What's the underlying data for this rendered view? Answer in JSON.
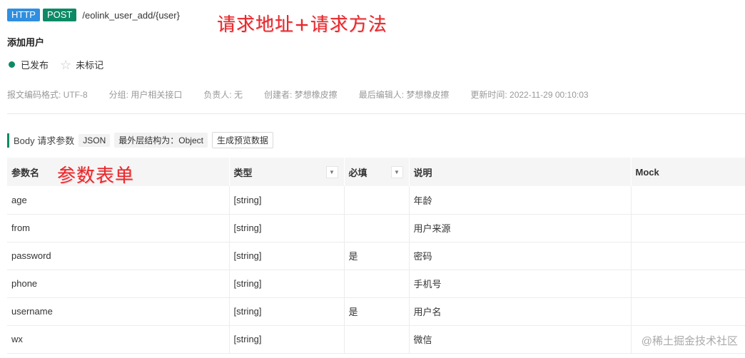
{
  "header": {
    "method_protocol": "HTTP",
    "method": "POST",
    "path": "/eolink_user_add/{user}"
  },
  "annotations": {
    "request_addr": "请求地址+请求方法",
    "param_form": "参数表单"
  },
  "api_name": "添加用户",
  "status": {
    "published": "已发布",
    "marked": "未标记"
  },
  "meta": {
    "encoding": "报文编码格式: UTF-8",
    "group": "分组: 用户相关接口",
    "owner": "负责人: 无",
    "creator": "创建者: 梦想橡皮擦",
    "last_editor": "最后编辑人: 梦想橡皮擦",
    "updated": "更新时间: 2022-11-29 00:10:03"
  },
  "body_section": {
    "label": "Body 请求参数",
    "format": "JSON",
    "structure": "最外层结构为：Object",
    "generate_button": "生成预览数据"
  },
  "table": {
    "headers": {
      "name": "参数名",
      "type": "类型",
      "required": "必填",
      "desc": "说明",
      "mock": "Mock"
    },
    "rows": [
      {
        "name": "age",
        "type": "[string]",
        "required": "",
        "desc": "年龄",
        "mock": ""
      },
      {
        "name": "from",
        "type": "[string]",
        "required": "",
        "desc": "用户来源",
        "mock": ""
      },
      {
        "name": "password",
        "type": "[string]",
        "required": "是",
        "desc": "密码",
        "mock": ""
      },
      {
        "name": "phone",
        "type": "[string]",
        "required": "",
        "desc": "手机号",
        "mock": ""
      },
      {
        "name": "username",
        "type": "[string]",
        "required": "是",
        "desc": "用户名",
        "mock": ""
      },
      {
        "name": "wx",
        "type": "[string]",
        "required": "",
        "desc": "微信",
        "mock": ""
      }
    ]
  },
  "watermark": "@稀土掘金技术社区",
  "colors": {
    "http_badge": "#2f8fe0",
    "post_badge": "#0d8a65",
    "annotation": "#e7282d"
  }
}
